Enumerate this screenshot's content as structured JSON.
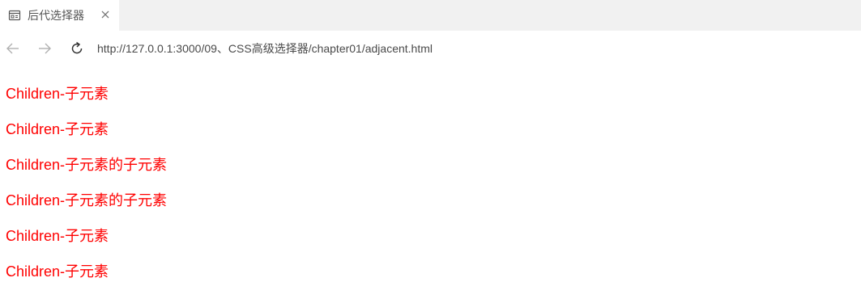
{
  "tab": {
    "title": "后代选择器",
    "icon": "page-icon"
  },
  "toolbar": {
    "url": "http://127.0.0.1:3000/09、CSS高级选择器/chapter01/adjacent.html",
    "back_icon": "back-arrow-icon",
    "forward_icon": "forward-arrow-icon",
    "reload_icon": "reload-icon"
  },
  "content": {
    "color": "#ff0000",
    "paragraphs": [
      "Children-子元素",
      "Children-子元素",
      "Children-子元素的子元素",
      "Children-子元素的子元素",
      "Children-子元素",
      "Children-子元素"
    ]
  }
}
